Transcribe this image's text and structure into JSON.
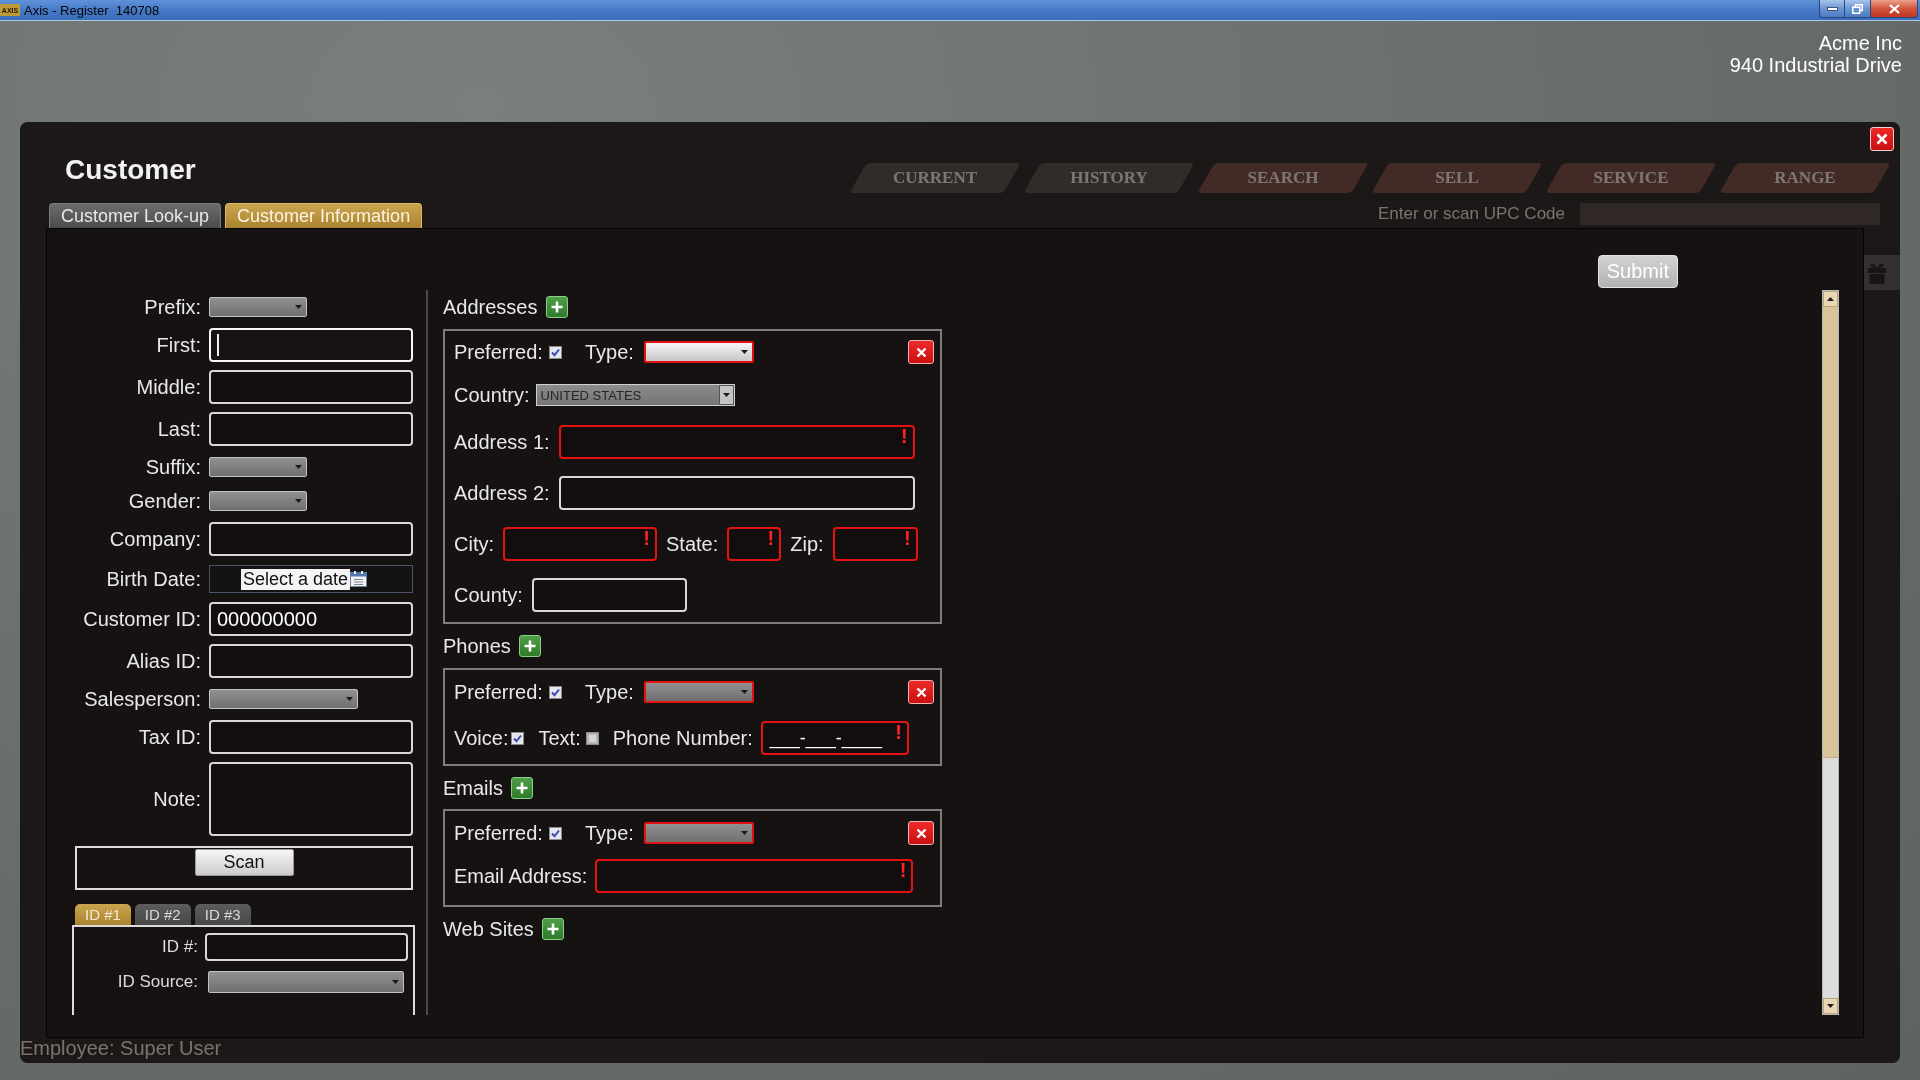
{
  "window": {
    "logo": "AXIS",
    "title": "Axis - Register  140708"
  },
  "store": {
    "name": "Acme Inc",
    "address": "940 Industrial Drive"
  },
  "background_app": {
    "tabs": [
      {
        "label": "CURRENT",
        "kind": "neutral"
      },
      {
        "label": "HISTORY",
        "kind": "neutral"
      },
      {
        "label": "SEARCH",
        "kind": "warm"
      },
      {
        "label": "SELL",
        "kind": "warm"
      },
      {
        "label": "SERVICE",
        "kind": "warm"
      },
      {
        "label": "RANGE",
        "kind": "warm"
      }
    ],
    "upc_prompt": "Enter or scan UPC Code",
    "employee": "Employee: Super User"
  },
  "dialog": {
    "title": "Customer",
    "tabs": [
      {
        "label": "Customer Look-up",
        "selected": false
      },
      {
        "label": "Customer Information",
        "selected": true
      }
    ],
    "submit": {
      "label": "Submit",
      "disabled": true
    },
    "person_fields": [
      {
        "label": "Prefix:",
        "kind": "select",
        "focused": false
      },
      {
        "label": "First:",
        "kind": "text",
        "focused": true
      },
      {
        "label": "Middle:",
        "kind": "text",
        "focused": false
      },
      {
        "label": "Last:",
        "kind": "text",
        "focused": false
      },
      {
        "label": "Suffix:",
        "kind": "select",
        "focused": false
      },
      {
        "label": "Gender:",
        "kind": "select",
        "focused": false
      },
      {
        "label": "Company:",
        "kind": "text",
        "focused": false
      },
      {
        "label": "Birth Date:",
        "kind": "date",
        "button": "Select a date",
        "focused": false
      },
      {
        "label": "Customer ID:",
        "kind": "text",
        "value": "000000000",
        "focused": false
      },
      {
        "label": "Alias ID:",
        "kind": "text",
        "focused": false
      },
      {
        "label": "Salesperson:",
        "kind": "select",
        "focused": false
      },
      {
        "label": "Tax ID:",
        "kind": "text",
        "focused": false
      },
      {
        "label": "Note:",
        "kind": "textarea",
        "focused": false
      }
    ],
    "scan_button": "Scan",
    "id_tabs": [
      {
        "label": "ID #1",
        "selected": true
      },
      {
        "label": "ID #2",
        "selected": false
      },
      {
        "label": "ID #3",
        "selected": false
      }
    ],
    "id_fields": [
      {
        "label": "ID #:",
        "kind": "text"
      },
      {
        "label": "ID Source:",
        "kind": "select"
      }
    ],
    "sections": [
      {
        "kind": "address",
        "heading": "Addresses",
        "entries": [
          {
            "preferred": {
              "label": "Preferred:",
              "checked": true
            },
            "type": {
              "label": "Type:",
              "invalid": true,
              "hovered": true
            },
            "country": {
              "label": "Country:",
              "value": "UNITED STATES"
            },
            "fields": [
              {
                "label": "Address 1:",
                "invalid": true,
                "alert": "!"
              },
              {
                "label": "Address 2:",
                "invalid": false
              },
              {
                "label": "City:",
                "invalid": true,
                "alert": "!"
              },
              {
                "label": "State:",
                "invalid": true,
                "alert": "!"
              },
              {
                "label": "Zip:",
                "invalid": true,
                "alert": "!"
              },
              {
                "label": "County:",
                "invalid": false
              }
            ]
          }
        ]
      },
      {
        "kind": "phone",
        "heading": "Phones",
        "entries": [
          {
            "preferred": {
              "label": "Preferred:",
              "checked": true
            },
            "type": {
              "label": "Type:",
              "invalid": true,
              "hovered": false
            },
            "voice": {
              "label": "Voice:",
              "checked": true
            },
            "text": {
              "label": "Text:",
              "checked": false
            },
            "number": {
              "label": "Phone Number:",
              "placeholder": "___-___-____",
              "invalid": true,
              "alert": "!"
            }
          }
        ]
      },
      {
        "kind": "email",
        "heading": "Emails",
        "entries": [
          {
            "preferred": {
              "label": "Preferred:",
              "checked": true
            },
            "type": {
              "label": "Type:",
              "invalid": true,
              "hovered": false
            },
            "address": {
              "label": "Email Address:",
              "invalid": true,
              "alert": "!"
            }
          }
        ]
      },
      {
        "kind": "website",
        "heading": "Web Sites"
      }
    ]
  }
}
